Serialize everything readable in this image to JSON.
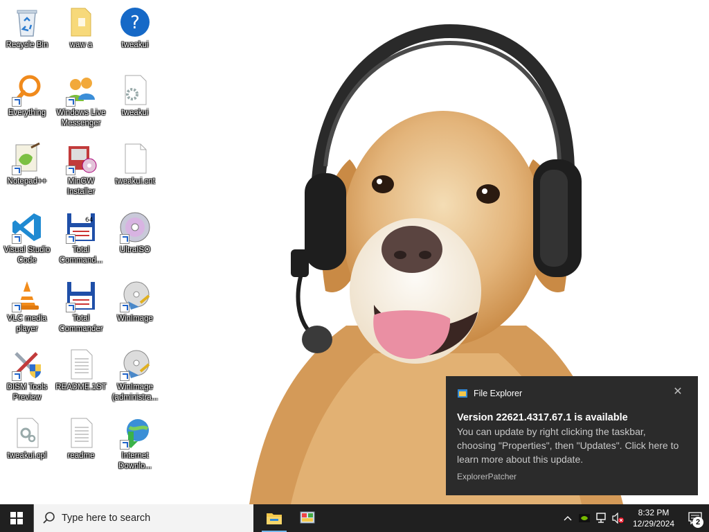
{
  "desktop": {
    "icons": [
      {
        "id": "recycle-bin",
        "label": "Recycle Bin",
        "icon": "recycle-bin-icon",
        "shortcut": false
      },
      {
        "id": "waw-a",
        "label": "waw a",
        "icon": "folder-icon",
        "shortcut": false
      },
      {
        "id": "tweakui-help",
        "label": "tweakui",
        "icon": "help-icon",
        "shortcut": false
      },
      {
        "id": "everything",
        "label": "Everything",
        "icon": "everything-search-icon",
        "shortcut": true
      },
      {
        "id": "windows-live-messenger",
        "label": "Windows Live Messenger",
        "icon": "messenger-icon",
        "shortcut": true
      },
      {
        "id": "tweakui-settings",
        "label": "tweakui",
        "icon": "settings-file-icon",
        "shortcut": false
      },
      {
        "id": "notepad-plus-plus",
        "label": "Notepad++",
        "icon": "notepad-plus-plus-icon",
        "shortcut": true
      },
      {
        "id": "mingw-installer",
        "label": "MinGW Installer",
        "icon": "mingw-installer-icon",
        "shortcut": true
      },
      {
        "id": "tweakui-cnt",
        "label": "tweakui.cnt",
        "icon": "blank-file-icon",
        "shortcut": false
      },
      {
        "id": "visual-studio-code",
        "label": "Visual Studio Code",
        "icon": "vscode-icon",
        "shortcut": true
      },
      {
        "id": "total-commander-64",
        "label": "Total Command...",
        "icon": "total-commander-64-icon",
        "shortcut": true
      },
      {
        "id": "ultraiso",
        "label": "UltraISO",
        "icon": "disc-icon",
        "shortcut": true
      },
      {
        "id": "vlc",
        "label": "VLC media player",
        "icon": "vlc-cone-icon",
        "shortcut": true
      },
      {
        "id": "total-commander",
        "label": "Total Commander",
        "icon": "floppy-icon",
        "shortcut": true
      },
      {
        "id": "winimage",
        "label": "WinImage",
        "icon": "winimage-disc-icon",
        "shortcut": true
      },
      {
        "id": "dism-tools",
        "label": "DISM Tools Preview",
        "icon": "tools-shield-icon",
        "shortcut": true
      },
      {
        "id": "readme-1st",
        "label": "README.1ST",
        "icon": "text-file-icon",
        "shortcut": false
      },
      {
        "id": "winimage-admin",
        "label": "WinImage (administra...",
        "icon": "winimage-disc-icon",
        "shortcut": true
      },
      {
        "id": "tweakui-cpl",
        "label": "tweakui.cpl",
        "icon": "control-panel-file-icon",
        "shortcut": false
      },
      {
        "id": "readme",
        "label": "readme",
        "icon": "text-file-icon",
        "shortcut": false
      },
      {
        "id": "internet-download-manager",
        "label": "Internet Downlo...",
        "icon": "idm-globe-icon",
        "shortcut": true
      }
    ]
  },
  "toast": {
    "app_name": "File Explorer",
    "title": "Version 22621.4317.67.1 is available",
    "body": "You can update by right clicking the taskbar, choosing \"Properties\", then \"Updates\". Click here to learn more about this update.",
    "attribution": "ExplorerPatcher",
    "close_glyph": "✕"
  },
  "taskbar": {
    "search_placeholder": "Type here to search",
    "apps": [
      {
        "id": "file-explorer",
        "icon": "file-explorer-icon",
        "active": true
      },
      {
        "id": "control-panel",
        "icon": "control-panel-icon",
        "active": false
      }
    ],
    "tray": {
      "time": "8:32 PM",
      "date": "12/29/2024",
      "notification_count": "2"
    }
  },
  "colors": {
    "taskbar_bg": "#202020",
    "toast_bg": "#2b2b2b",
    "accent": "#76b9ed"
  }
}
